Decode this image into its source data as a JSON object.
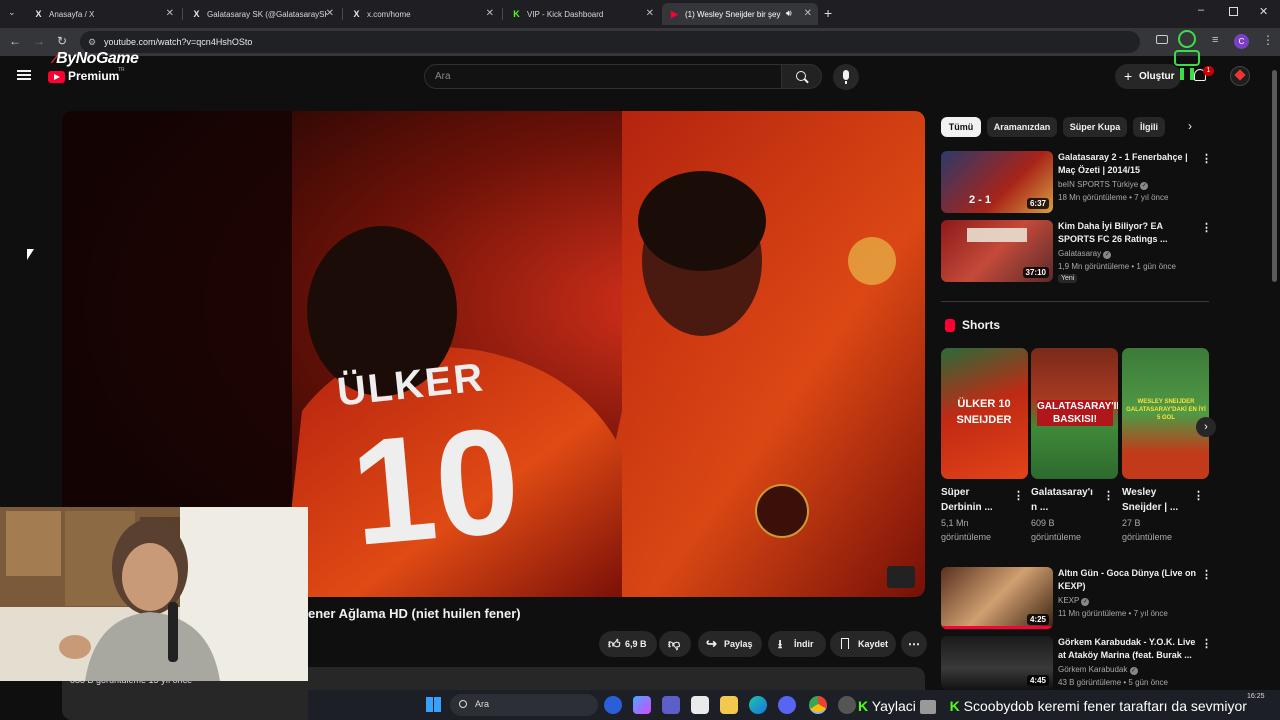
{
  "browser": {
    "tabs": [
      {
        "label": "Anasayfa / X",
        "icon": "x-logo-icon"
      },
      {
        "label": "Galatasaray SK (@GalatasaraySK",
        "icon": "x-logo-icon"
      },
      {
        "label": "x.com/home",
        "icon": "x-logo-icon"
      },
      {
        "label": "VIP - Kick Dashboard",
        "icon": "kick-logo-icon"
      },
      {
        "label": "(1) Wesley Sneijder bir şey",
        "icon": "youtube-logo-icon"
      }
    ],
    "url": "youtube.com/watch?v=qcn4HshOSto",
    "profile_initial": "C"
  },
  "overlay": {
    "channel_brand": "ByNoGame"
  },
  "youtube": {
    "logo_text": "Premium",
    "logo_region": "TR",
    "search_placeholder": "Ara",
    "create_label": "Oluştur",
    "notification_count": "1"
  },
  "video": {
    "title": "ener Ağlama HD (niet huilen fener)",
    "likes": "6,9 B",
    "share_label": "Paylaş",
    "download_label": "İndir",
    "save_label": "Kaydet",
    "views_partial": "888 B görüntüleme  15 yıl önce",
    "jersey_sponsor": "ÜLKER",
    "jersey_number": "10"
  },
  "filters": [
    "Tümü",
    "Aramanızdan",
    "Süper Kupa",
    "İlgili"
  ],
  "related": [
    {
      "title": "Galatasaray 2 - 1 Fenerbahçe | Maç Özeti | 2014/15",
      "channel": "beIN SPORTS Türkiye",
      "meta": "18 Mn görüntüleme • 7 yıl önce",
      "duration": "6:37",
      "thumb_score": "2 - 1",
      "badge": ""
    },
    {
      "title": "Kim Daha İyi Biliyor? EA SPORTS FC 26 Ratings ...",
      "channel": "Galatasaray",
      "meta": "1,9 Mn görüntüleme • 1 gün önce",
      "duration": "37:10",
      "thumb_score": "",
      "badge": "Yeni"
    }
  ],
  "shorts": {
    "heading": "Shorts",
    "items": [
      {
        "title1": "Süper",
        "title2": "Derbinin ...",
        "views1": "5,1 Mn",
        "views2": "görüntüleme",
        "overlay": "ÜLKER 10 SNEIJDER"
      },
      {
        "title1": "Galatasaray'ı",
        "title2": "n ...",
        "views1": "609 B",
        "views2": "görüntüleme",
        "overlay": "GALATASARAY'IN BASKISI!"
      },
      {
        "title1": "Wesley",
        "title2": "Sneijder | ...",
        "views1": "27 B",
        "views2": "görüntüleme",
        "overlay": "WESLEY SNEIJDER GALATASARAY'DAKİ EN İYİ 5 GOL"
      }
    ]
  },
  "related2": [
    {
      "title": "Altın Gün - Goca Dünya (Live on KEXP)",
      "channel": "KEXP",
      "meta": "11 Mn görüntüleme • 7 yıl önce",
      "duration": "4:25"
    },
    {
      "title": "Görkem Karabudak - Y.O.K. Live at Ataköy Marina (feat. Burak ...",
      "channel": "Görkem Karabudak",
      "meta": "43 B görüntüleme • 5 gün önce",
      "duration": "4:45"
    }
  ],
  "taskbar": {
    "search_label": "Ara",
    "clock": "16:25"
  },
  "chat_ticker": {
    "user1": "Yaylaci",
    "user2": "Scoobydob",
    "message": "keremi fener taraftarı da sevmiyor"
  }
}
